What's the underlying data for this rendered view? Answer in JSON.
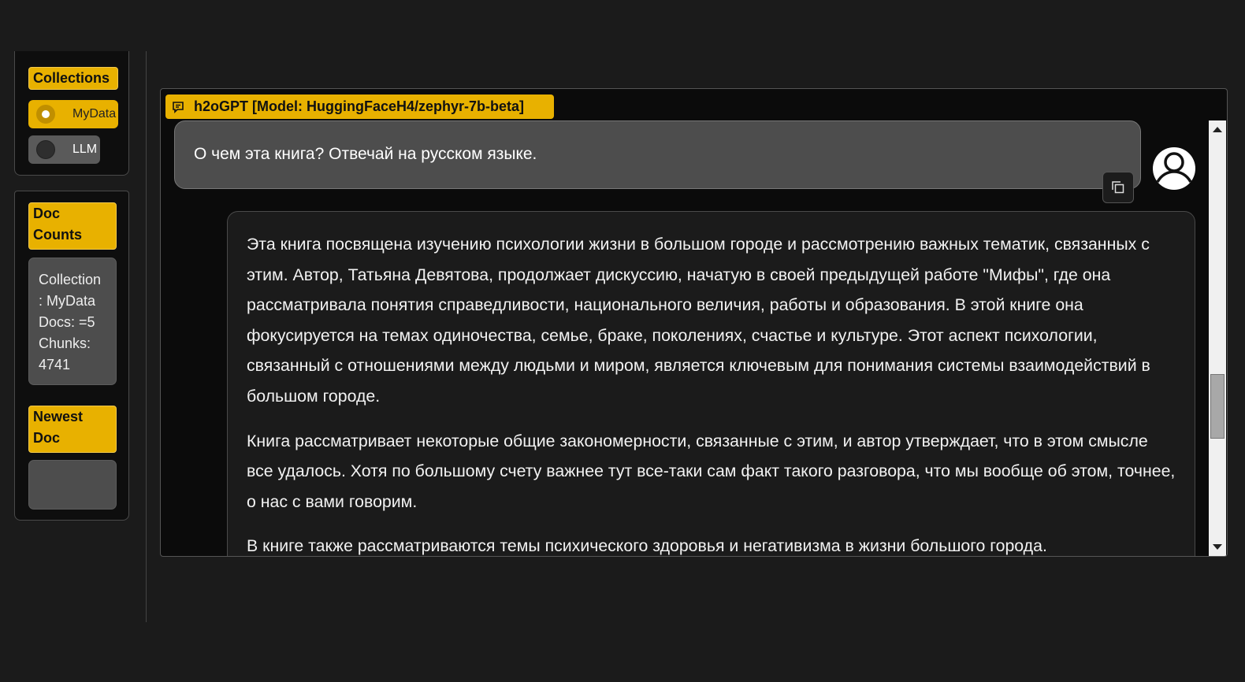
{
  "sidebar": {
    "collections": {
      "label": "Collections",
      "options": [
        {
          "label": "MyData",
          "selected": true
        },
        {
          "label": "LLM",
          "selected": false
        }
      ]
    },
    "doc_counts": {
      "label": "Doc Counts",
      "lines": [
        "Collection",
        ": MyData",
        "Docs: =5",
        "Chunks:",
        "4741"
      ]
    },
    "newest_doc": {
      "label": "Newest Doc",
      "value": ""
    }
  },
  "chat": {
    "title": "h2oGPT [Model: HuggingFaceH4/zephyr-7b-beta]",
    "user_message": "О чем эта книга? Отвечай на русском языке.",
    "bot_paragraphs": [
      "Эта книга посвящена изучению психологии жизни в большом городе и рассмотрению важных тематик, связанных с этим. Автор, Татьяна Девятова, продолжает дискуссию, начатую в своей предыдущей работе \"Мифы\", где она рассматривала понятия справедливости, национального величия, работы и образования. В этой книге она фокусируется на темах одиночества, семье, браке, поколениях, счастье и культуре. Этот аспект психологии, связанный с отношениями между людьми и миром, является ключевым для понимания системы взаимодействий в большом городе.",
      "Книга рассматривает некоторые общие закономерности, связанные с этим, и автор утверждает, что в этом смысле все удалось. Хотя по большому счету важнее тут все-таки сам факт такого разговора, что мы вообще об этом, точнее, о нас с вами говорим.",
      "В книге также рассматриваются темы психического здоровья и негативизма в жизни большого города."
    ]
  },
  "colors": {
    "accent": "#e8b100",
    "background": "#1b1b1b",
    "user_bubble": "#4d4d4d"
  }
}
